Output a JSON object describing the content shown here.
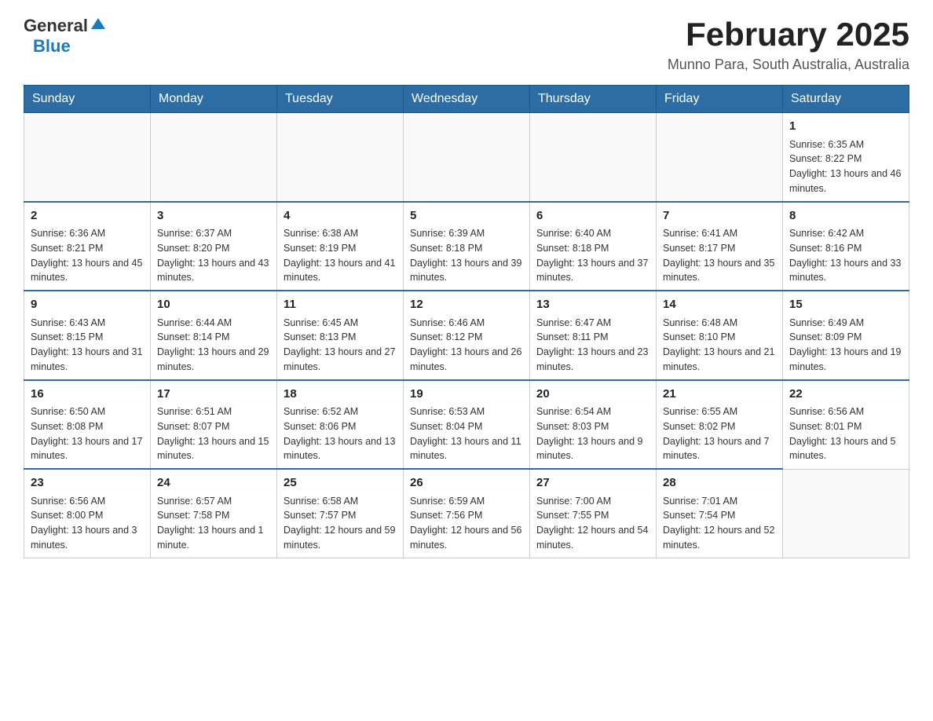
{
  "header": {
    "logo_general": "General",
    "logo_blue": "Blue",
    "title": "February 2025",
    "subtitle": "Munno Para, South Australia, Australia"
  },
  "days_of_week": [
    "Sunday",
    "Monday",
    "Tuesday",
    "Wednesday",
    "Thursday",
    "Friday",
    "Saturday"
  ],
  "weeks": [
    [
      {
        "day": "",
        "info": ""
      },
      {
        "day": "",
        "info": ""
      },
      {
        "day": "",
        "info": ""
      },
      {
        "day": "",
        "info": ""
      },
      {
        "day": "",
        "info": ""
      },
      {
        "day": "",
        "info": ""
      },
      {
        "day": "1",
        "info": "Sunrise: 6:35 AM\nSunset: 8:22 PM\nDaylight: 13 hours and 46 minutes."
      }
    ],
    [
      {
        "day": "2",
        "info": "Sunrise: 6:36 AM\nSunset: 8:21 PM\nDaylight: 13 hours and 45 minutes."
      },
      {
        "day": "3",
        "info": "Sunrise: 6:37 AM\nSunset: 8:20 PM\nDaylight: 13 hours and 43 minutes."
      },
      {
        "day": "4",
        "info": "Sunrise: 6:38 AM\nSunset: 8:19 PM\nDaylight: 13 hours and 41 minutes."
      },
      {
        "day": "5",
        "info": "Sunrise: 6:39 AM\nSunset: 8:18 PM\nDaylight: 13 hours and 39 minutes."
      },
      {
        "day": "6",
        "info": "Sunrise: 6:40 AM\nSunset: 8:18 PM\nDaylight: 13 hours and 37 minutes."
      },
      {
        "day": "7",
        "info": "Sunrise: 6:41 AM\nSunset: 8:17 PM\nDaylight: 13 hours and 35 minutes."
      },
      {
        "day": "8",
        "info": "Sunrise: 6:42 AM\nSunset: 8:16 PM\nDaylight: 13 hours and 33 minutes."
      }
    ],
    [
      {
        "day": "9",
        "info": "Sunrise: 6:43 AM\nSunset: 8:15 PM\nDaylight: 13 hours and 31 minutes."
      },
      {
        "day": "10",
        "info": "Sunrise: 6:44 AM\nSunset: 8:14 PM\nDaylight: 13 hours and 29 minutes."
      },
      {
        "day": "11",
        "info": "Sunrise: 6:45 AM\nSunset: 8:13 PM\nDaylight: 13 hours and 27 minutes."
      },
      {
        "day": "12",
        "info": "Sunrise: 6:46 AM\nSunset: 8:12 PM\nDaylight: 13 hours and 26 minutes."
      },
      {
        "day": "13",
        "info": "Sunrise: 6:47 AM\nSunset: 8:11 PM\nDaylight: 13 hours and 23 minutes."
      },
      {
        "day": "14",
        "info": "Sunrise: 6:48 AM\nSunset: 8:10 PM\nDaylight: 13 hours and 21 minutes."
      },
      {
        "day": "15",
        "info": "Sunrise: 6:49 AM\nSunset: 8:09 PM\nDaylight: 13 hours and 19 minutes."
      }
    ],
    [
      {
        "day": "16",
        "info": "Sunrise: 6:50 AM\nSunset: 8:08 PM\nDaylight: 13 hours and 17 minutes."
      },
      {
        "day": "17",
        "info": "Sunrise: 6:51 AM\nSunset: 8:07 PM\nDaylight: 13 hours and 15 minutes."
      },
      {
        "day": "18",
        "info": "Sunrise: 6:52 AM\nSunset: 8:06 PM\nDaylight: 13 hours and 13 minutes."
      },
      {
        "day": "19",
        "info": "Sunrise: 6:53 AM\nSunset: 8:04 PM\nDaylight: 13 hours and 11 minutes."
      },
      {
        "day": "20",
        "info": "Sunrise: 6:54 AM\nSunset: 8:03 PM\nDaylight: 13 hours and 9 minutes."
      },
      {
        "day": "21",
        "info": "Sunrise: 6:55 AM\nSunset: 8:02 PM\nDaylight: 13 hours and 7 minutes."
      },
      {
        "day": "22",
        "info": "Sunrise: 6:56 AM\nSunset: 8:01 PM\nDaylight: 13 hours and 5 minutes."
      }
    ],
    [
      {
        "day": "23",
        "info": "Sunrise: 6:56 AM\nSunset: 8:00 PM\nDaylight: 13 hours and 3 minutes."
      },
      {
        "day": "24",
        "info": "Sunrise: 6:57 AM\nSunset: 7:58 PM\nDaylight: 13 hours and 1 minute."
      },
      {
        "day": "25",
        "info": "Sunrise: 6:58 AM\nSunset: 7:57 PM\nDaylight: 12 hours and 59 minutes."
      },
      {
        "day": "26",
        "info": "Sunrise: 6:59 AM\nSunset: 7:56 PM\nDaylight: 12 hours and 56 minutes."
      },
      {
        "day": "27",
        "info": "Sunrise: 7:00 AM\nSunset: 7:55 PM\nDaylight: 12 hours and 54 minutes."
      },
      {
        "day": "28",
        "info": "Sunrise: 7:01 AM\nSunset: 7:54 PM\nDaylight: 12 hours and 52 minutes."
      },
      {
        "day": "",
        "info": ""
      }
    ]
  ]
}
